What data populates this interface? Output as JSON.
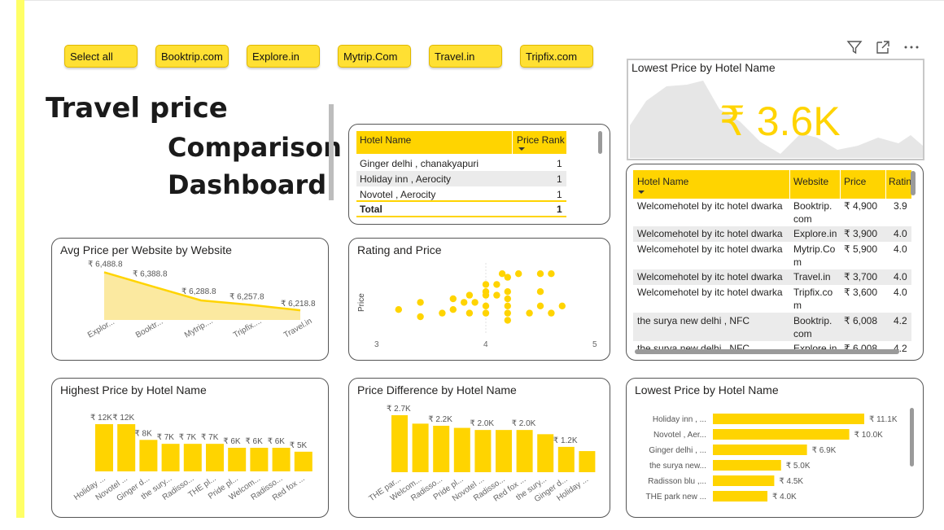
{
  "slicer": [
    "Select all",
    "Booktrip.com",
    "Explore.in",
    "Mytrip.Com",
    "Travel.in",
    "Tripfix.com"
  ],
  "title": {
    "line1": "Travel price",
    "line2": "Comparison",
    "line3": "Dashboard"
  },
  "rank_table": {
    "headers": [
      "Hotel Name",
      "Price Rank"
    ],
    "rows": [
      [
        "Ginger delhi , chanakyapuri",
        "1"
      ],
      [
        "Holiday inn , Aerocity",
        "1"
      ],
      [
        "Novotel , Aerocity",
        "1"
      ]
    ],
    "total": [
      "Total",
      "1"
    ]
  },
  "kpi": {
    "title": "Lowest Price by Hotel Name",
    "value": "₹ 3.6K"
  },
  "detail_table": {
    "headers": [
      "Hotel Name",
      "Website",
      "Price",
      "Ratin"
    ],
    "rows": [
      [
        "Welcomehotel by itc hotel dwarka",
        "Booktrip.",
        "com",
        "₹ 4,900",
        "3.9"
      ],
      [
        "Welcomehotel by itc hotel dwarka",
        "Explore.in",
        "",
        "₹ 3,900",
        "4.0"
      ],
      [
        "Welcomehotel by itc hotel dwarka",
        "Mytrip.Co",
        "m",
        "₹ 5,900",
        "4.0"
      ],
      [
        "Welcomehotel by itc hotel dwarka",
        "Travel.in",
        "",
        "₹ 3,700",
        "4.0"
      ],
      [
        "Welcomehotel by itc hotel dwarka",
        "Tripfix.co",
        "m",
        "₹ 3,600",
        "4.0"
      ],
      [
        "the surya new delhi , NFC",
        "Booktrip.",
        "com",
        "₹ 6,008",
        "4.2"
      ],
      [
        "the surya new delhi , NFC",
        "Explore.in",
        "",
        "₹ 6,008",
        "4.2"
      ]
    ]
  },
  "colors": {
    "accent": "#ffd400",
    "bar": "#ffd400",
    "accent_bar": "#ffff66"
  },
  "chart_data": [
    {
      "type": "area",
      "title": "Avg Price per Website by Website",
      "categories": [
        "Explor...",
        "Booktr...",
        "Mytrip....",
        "Tripfix....",
        "Travel.in"
      ],
      "values": [
        6488.8,
        6388.8,
        6288.8,
        6257.8,
        6218.8
      ],
      "labels": [
        "₹ 6,488.8",
        "₹ 6,388.8",
        "₹ 6,288.8",
        "₹ 6,257.8",
        "₹ 6,218.8"
      ],
      "ylim": [
        6150,
        6520
      ]
    },
    {
      "type": "scatter",
      "title": "Rating and Price",
      "ylabel": "Price",
      "xticks": [
        "3",
        "4",
        "5"
      ],
      "xlim": [
        3,
        5
      ],
      "points": [
        [
          3.2,
          0.35
        ],
        [
          3.4,
          0.25
        ],
        [
          3.4,
          0.45
        ],
        [
          3.6,
          0.3
        ],
        [
          3.7,
          0.5
        ],
        [
          3.7,
          0.35
        ],
        [
          3.8,
          0.45
        ],
        [
          3.85,
          0.55
        ],
        [
          3.85,
          0.3
        ],
        [
          3.9,
          0.45
        ],
        [
          4.0,
          0.3
        ],
        [
          4.0,
          0.4
        ],
        [
          4.0,
          0.55
        ],
        [
          4.0,
          0.6
        ],
        [
          4.0,
          0.7
        ],
        [
          4.1,
          0.7
        ],
        [
          4.1,
          0.55
        ],
        [
          4.15,
          0.85
        ],
        [
          4.2,
          0.6
        ],
        [
          4.2,
          0.5
        ],
        [
          4.2,
          0.4
        ],
        [
          4.2,
          0.3
        ],
        [
          4.2,
          0.2
        ],
        [
          4.2,
          0.8
        ],
        [
          4.3,
          0.85
        ],
        [
          4.4,
          0.3
        ],
        [
          4.5,
          0.85
        ],
        [
          4.5,
          0.6
        ],
        [
          4.5,
          0.4
        ],
        [
          4.6,
          0.3
        ],
        [
          4.6,
          0.85
        ],
        [
          4.7,
          0.4
        ]
      ]
    },
    {
      "type": "bar",
      "title": "Highest Price by Hotel Name",
      "categories": [
        "Holiday ...",
        "Novotel ...",
        "Ginger d...",
        "the sury...",
        "Radisso...",
        "THE pl...",
        "Pride pl...",
        "Welcom...",
        "Radisso...",
        "Red fox ..."
      ],
      "values": [
        12,
        12,
        8,
        7,
        7,
        7,
        6,
        6,
        6,
        5
      ],
      "labels": [
        "₹ 12K",
        "₹ 12K",
        "₹ 8K",
        "₹ 7K",
        "₹ 7K",
        "₹ 7K",
        "₹ 6K",
        "₹ 6K",
        "₹ 6K",
        "₹ 5K"
      ],
      "ylim": [
        0,
        12
      ]
    },
    {
      "type": "bar",
      "title": "Price Difference by Hotel Name",
      "categories": [
        "THE par...",
        "Welcom...",
        "Radisso...",
        "Pride pl...",
        "Novotel ...",
        "Radisso...",
        "Red fox ...",
        "the sury...",
        "Ginger d...",
        "Holiday ..."
      ],
      "values": [
        2.7,
        2.3,
        2.2,
        2.1,
        2.0,
        2.0,
        2.0,
        1.8,
        1.2,
        1.0
      ],
      "labels": [
        "₹ 2.7K",
        "",
        "₹ 2.2K",
        "",
        "₹ 2.0K",
        "",
        "₹ 2.0K",
        "",
        "₹ 1.2K",
        ""
      ],
      "ylim": [
        0,
        2.7
      ]
    },
    {
      "type": "bar",
      "orientation": "horizontal",
      "title": "Lowest Price by Hotel Name",
      "categories": [
        "Holiday inn , ...",
        "Novotel , Aer...",
        "Ginger delhi , ...",
        "the surya new...",
        "Radisson blu ,...",
        "THE park new ..."
      ],
      "values": [
        11.1,
        10.0,
        6.9,
        5.0,
        4.5,
        4.0
      ],
      "labels": [
        "₹ 11.1K",
        "₹ 10.0K",
        "₹ 6.9K",
        "₹ 5.0K",
        "₹ 4.5K",
        "₹ 4.0K"
      ],
      "xlim": [
        0,
        11.1
      ]
    }
  ]
}
